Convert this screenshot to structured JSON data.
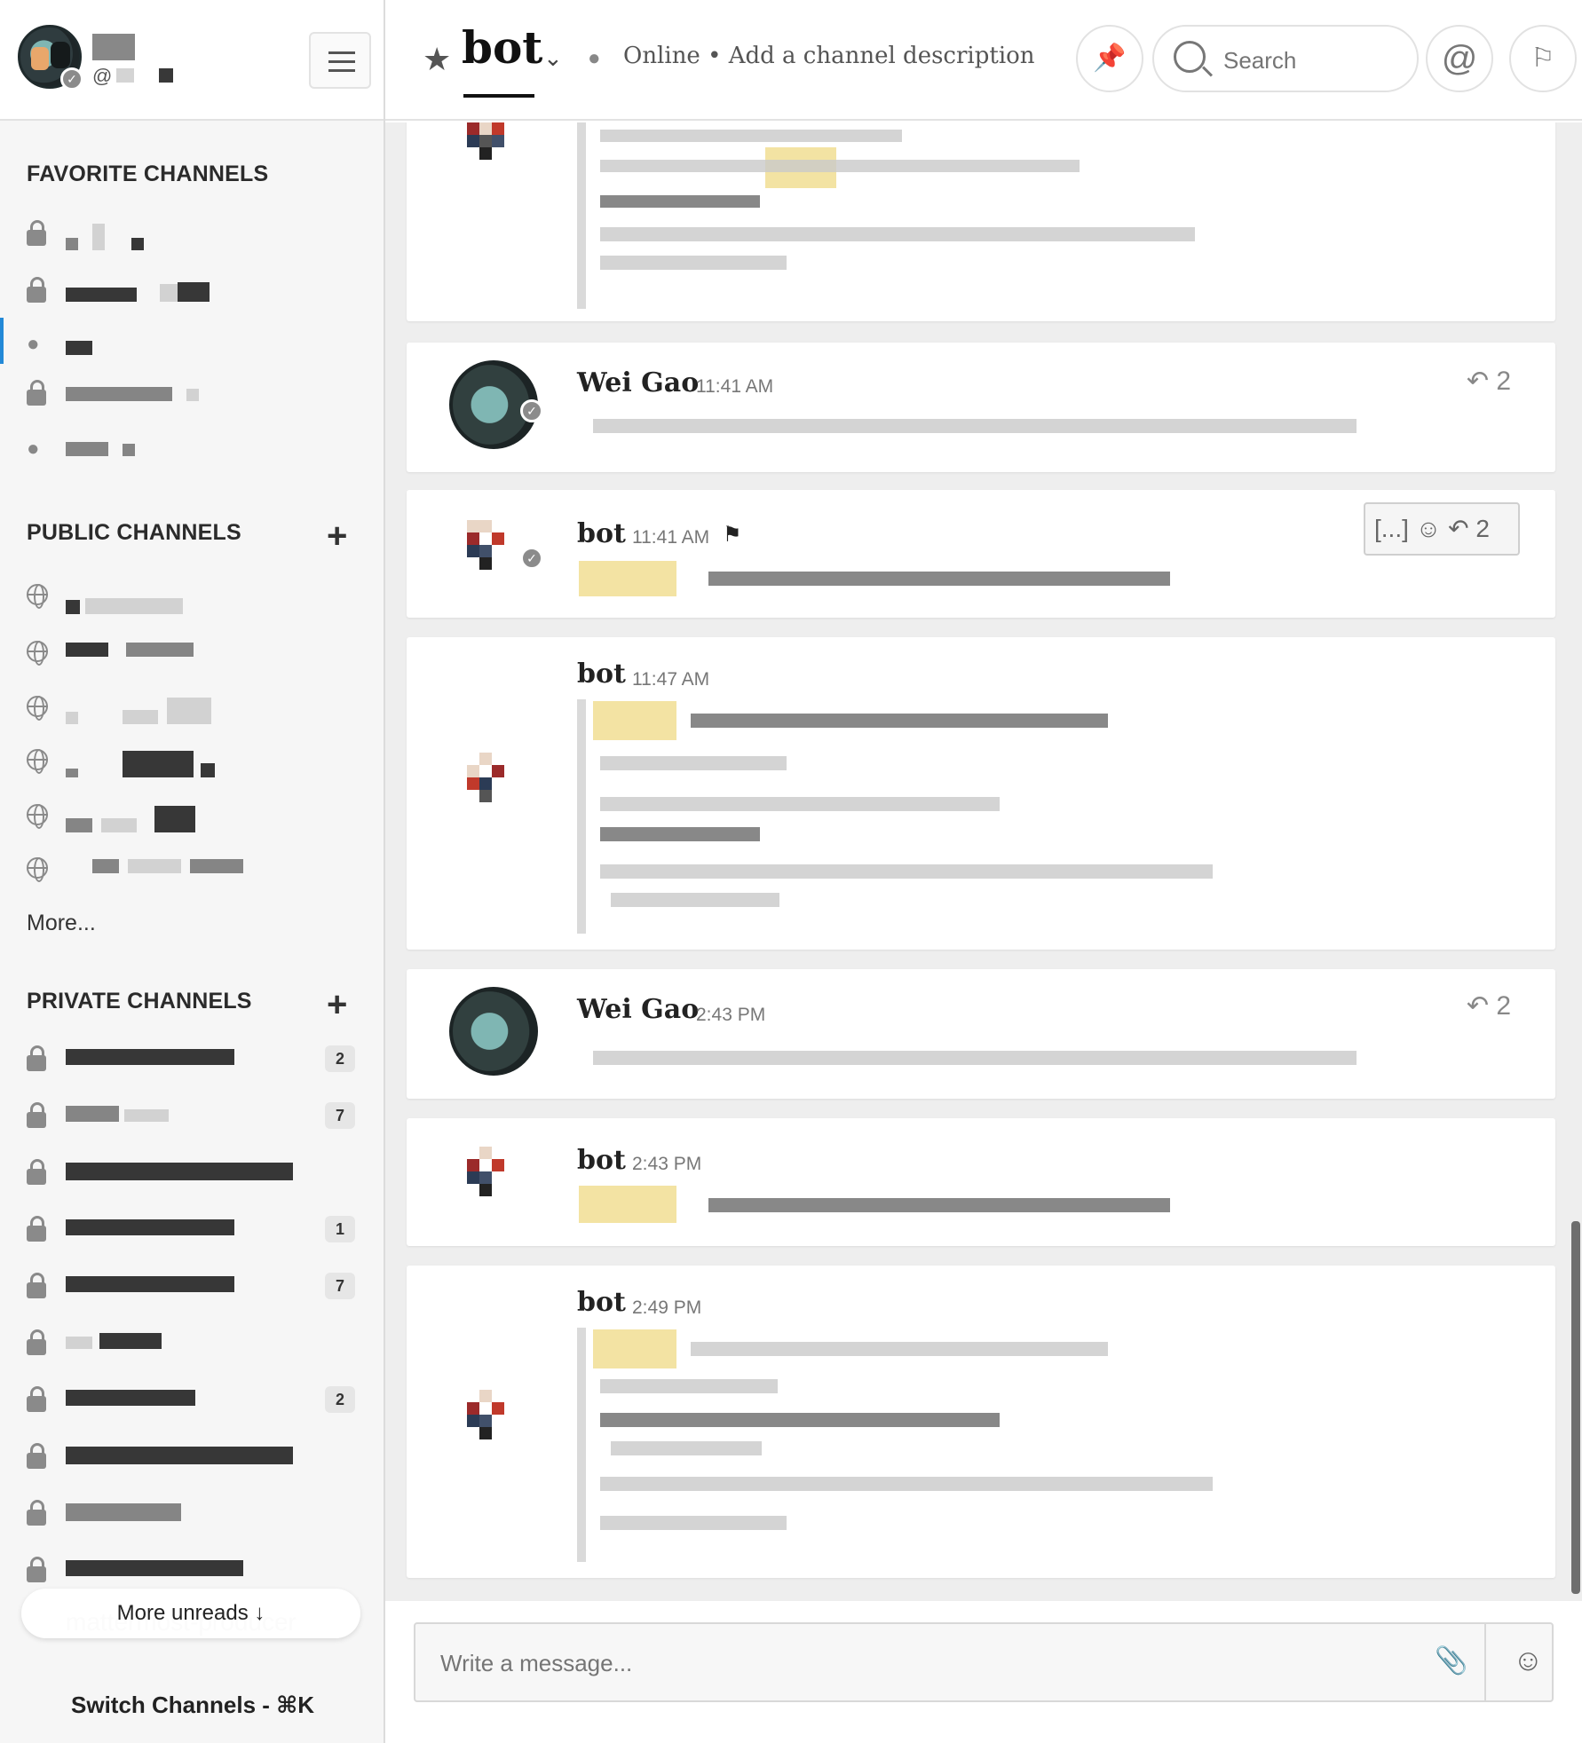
{
  "sidebar": {
    "sections": {
      "favorite": "FAVORITE CHANNELS",
      "public": "PUBLIC CHANNELS",
      "private": "PRIVATE CHANNELS"
    },
    "more_link": "More...",
    "private_badges": [
      "2",
      "7",
      "1",
      "7",
      "2"
    ],
    "more_unreads": "More unreads ↓",
    "ghost_channel": "mattermost-producer",
    "switch_channels": "Switch Channels - ⌘K"
  },
  "header": {
    "channel_title": "bot",
    "status": "Online • Add a channel description",
    "search_placeholder": "Search"
  },
  "posts": [
    {
      "author": "",
      "time": ""
    },
    {
      "author": "Wei Gao",
      "time": "11:41 AM",
      "replies": "2"
    },
    {
      "author": "bot",
      "time": "11:41 AM",
      "replies": "2",
      "hover": "[...]"
    },
    {
      "author": "bot",
      "time": "11:47 AM"
    },
    {
      "author": "Wei Gao",
      "time": "2:43 PM",
      "replies": "2"
    },
    {
      "author": "bot",
      "time": "2:43 PM"
    },
    {
      "author": "bot",
      "time": "2:49 PM"
    }
  ],
  "composer": {
    "placeholder": "Write a message..."
  },
  "colors": {
    "accent_active": "#2389d7",
    "highlight": "#f3e3a3",
    "background": "#eeeeee"
  }
}
